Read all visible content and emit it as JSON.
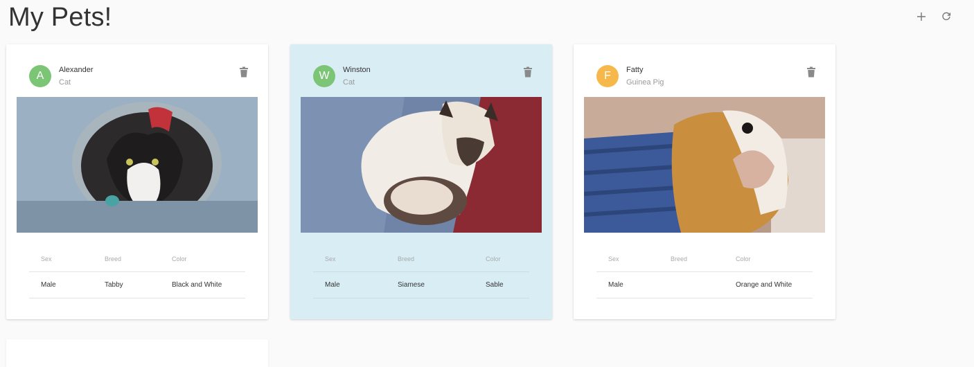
{
  "page": {
    "title": "My Pets!"
  },
  "header_actions": {
    "add_icon": "plus-icon",
    "refresh_icon": "refresh-icon"
  },
  "table_headers": {
    "sex": "Sex",
    "breed": "Breed",
    "color": "Color"
  },
  "pets": [
    {
      "initial": "A",
      "name": "Alexander",
      "type": "Cat",
      "avatar_color": "#7cc576",
      "sex": "Male",
      "breed": "Tabby",
      "color": "Black and White",
      "selected": false
    },
    {
      "initial": "W",
      "name": "Winston",
      "type": "Cat",
      "avatar_color": "#7cc576",
      "sex": "Male",
      "breed": "Siamese",
      "color": "Sable",
      "selected": true
    },
    {
      "initial": "F",
      "name": "Fatty",
      "type": "Guinea Pig",
      "avatar_color": "#f7b84b",
      "sex": "Male",
      "breed": "",
      "color": "Orange and White",
      "selected": false
    }
  ],
  "colors": {
    "selected_card_bg": "#d8edf4",
    "page_bg": "#fafafa"
  }
}
